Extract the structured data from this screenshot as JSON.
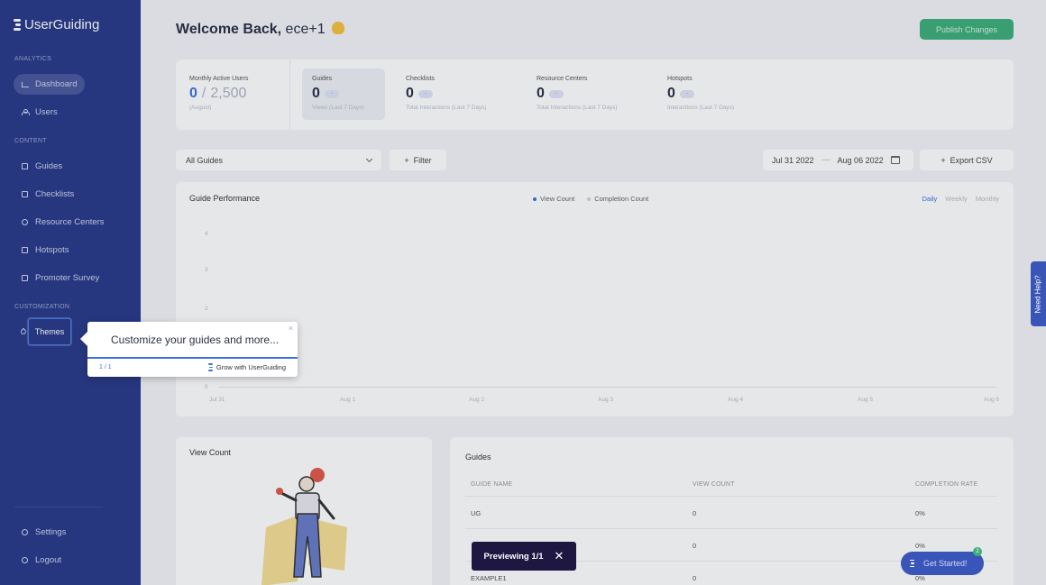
{
  "sidebar": {
    "brand": "UserGuiding",
    "sections": {
      "analytics": "ANALYTICS",
      "content": "CONTENT",
      "customization": "CUSTOMIZATION"
    },
    "items": {
      "dashboard": "Dashboard",
      "users": "Users",
      "guides": "Guides",
      "checklists": "Checklists",
      "resource_centers": "Resource Centers",
      "hotspots": "Hotspots",
      "promoter_survey": "Promoter Survey",
      "themes": "Themes",
      "settings": "Settings",
      "logout": "Logout"
    }
  },
  "header": {
    "welcome": "Welcome Back,",
    "user": "ece+1",
    "publish": "Publish Changes"
  },
  "stats": {
    "mau": {
      "label": "Monthly Active Users",
      "value": "0",
      "max": "2,500",
      "sub": "(August)"
    },
    "guides": {
      "label": "Guides",
      "value": "0",
      "pill": "-",
      "sub": "Views (Last 7 Days)"
    },
    "checklists": {
      "label": "Checklists",
      "value": "0",
      "pill": "-",
      "sub": "Total Interactions (Last 7 Days)"
    },
    "resource_centers": {
      "label": "Resource Centers",
      "value": "0",
      "pill": "-",
      "sub": "Total Interactions (Last 7 Days)"
    },
    "hotspots": {
      "label": "Hotspots",
      "value": "0",
      "pill": "-",
      "sub": "Interactions (Last 7 Days)"
    }
  },
  "filters": {
    "select": "All Guides",
    "filter": "Filter",
    "date_from": "Jul 31 2022",
    "date_to": "Aug 06 2022",
    "export": "Export CSV"
  },
  "performance": {
    "title": "Guide Performance",
    "legend": {
      "view": "View Count",
      "completion": "Completion Count"
    },
    "period": {
      "daily": "Daily",
      "weekly": "Weekly",
      "monthly": "Monthly"
    },
    "y_ticks": [
      "4",
      "3",
      "2",
      "0"
    ],
    "x_ticks": [
      "Jul 31",
      "Aug 1",
      "Aug 2",
      "Aug 3",
      "Aug 4",
      "Aug 5",
      "Aug 6"
    ]
  },
  "view_count": {
    "title": "View Count"
  },
  "guides_table": {
    "title": "Guides",
    "headers": {
      "name": "GUIDE NAME",
      "views": "VIEW COUNT",
      "rate": "COMPLETION RATE"
    },
    "rows": [
      {
        "name": "UG",
        "views": "0",
        "rate": "0%"
      },
      {
        "name": "",
        "views": "0",
        "rate": "0%"
      },
      {
        "name": "EXAMPLE1",
        "views": "0",
        "rate": "0%"
      }
    ]
  },
  "tooltip": {
    "text": "Customize your guides and more...",
    "close": "×",
    "step": "1 / 1",
    "brand": "Grow with UserGuiding"
  },
  "need_help": "Need Help?",
  "previewing": {
    "label": "Previewing 1/1",
    "close": "✕"
  },
  "get_started": {
    "label": "Get Started!",
    "badge": "2"
  },
  "colors": {
    "sidebar": "#2b3c8a",
    "accent": "#3e6fe0",
    "publish": "#3fae7a",
    "preview_bar": "#1d1742"
  }
}
